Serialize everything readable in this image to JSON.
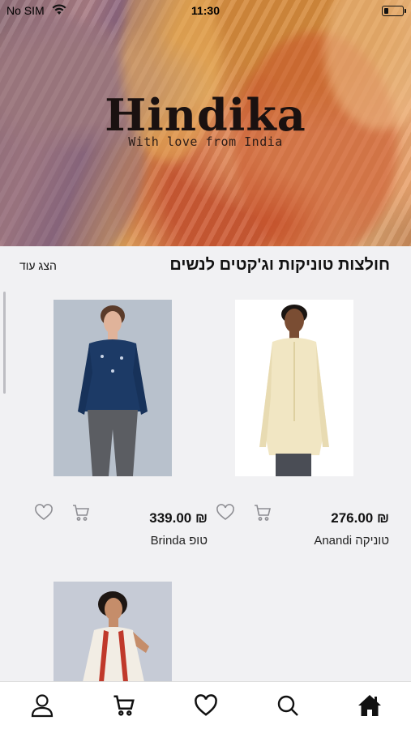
{
  "status_bar": {
    "carrier": "No SIM",
    "time": "11:30",
    "battery_level": 0.25
  },
  "hero": {
    "brand": "Hindika",
    "tagline": "With love from India"
  },
  "section": {
    "title": "חולצות טוניקות וג'קטים לנשים",
    "show_more": "הצג עוד"
  },
  "products": [
    {
      "price": "₪ 276.00",
      "name": "טוניקה Anandi",
      "photo_colors": {
        "bg": "#ffffff",
        "garment": "#f1e6c3"
      }
    },
    {
      "price": "₪ 339.00",
      "name": "טופ Brinda",
      "photo_colors": {
        "bg": "#b8c1cc",
        "garment": "#1c3a66"
      }
    },
    {
      "price": "",
      "name": "",
      "photo_colors": {
        "bg": "#c6cbd6",
        "garment": "#f2ede4"
      }
    }
  ],
  "tab_bar": {
    "tabs": [
      {
        "icon": "home-icon"
      },
      {
        "icon": "search-icon"
      },
      {
        "icon": "heart-icon"
      },
      {
        "icon": "cart-icon"
      },
      {
        "icon": "user-icon"
      }
    ]
  }
}
